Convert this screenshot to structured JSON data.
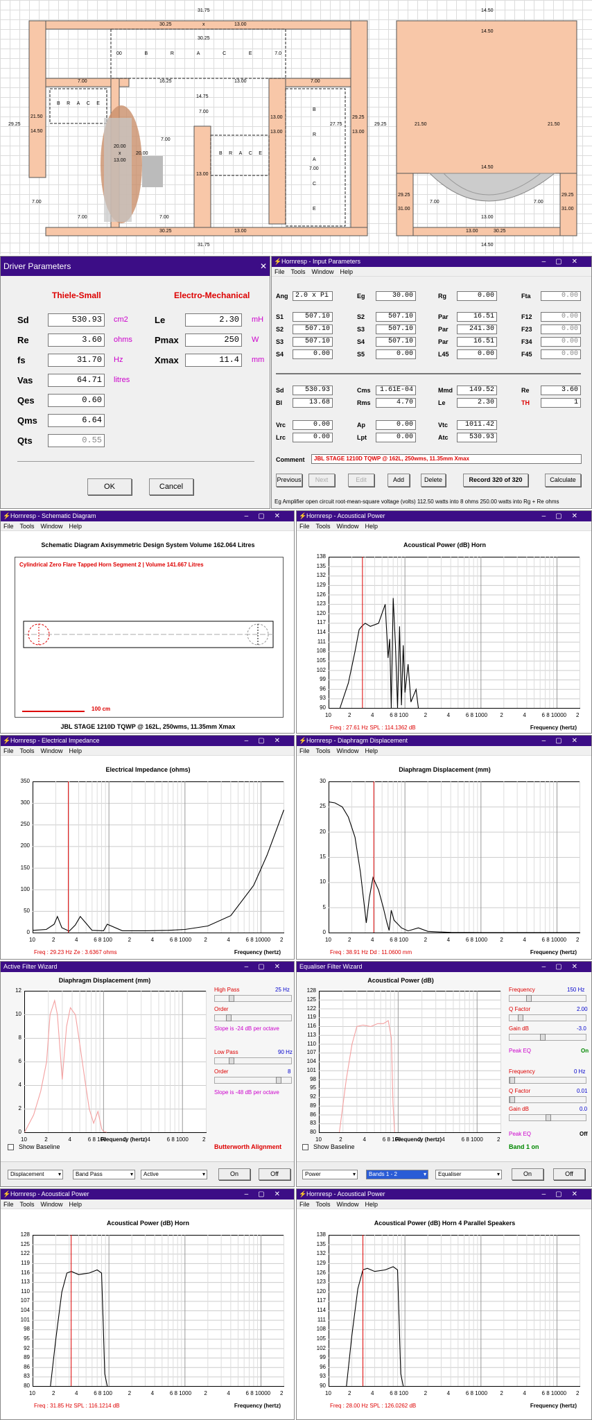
{
  "cad": {
    "left_dims": {
      "top_outer": "31.75",
      "top_a": "30.25",
      "top_b": "13.00",
      "brace_top_width": "30.25",
      "brace_top_letters": [
        "00",
        "B",
        "R",
        "A",
        "C",
        "E",
        "7.0"
      ],
      "left_height": "29.25",
      "left_inner_a": "21.50",
      "left_inner_b": "14.50",
      "left_seven": "7.00",
      "mid_a": "16.25",
      "mid_b": "13.00",
      "mid_right_seven": "7.00",
      "left_brace_width": "7.00",
      "left_brace_letters": [
        "B",
        "R",
        "A",
        "C",
        "E"
      ],
      "center_width": "14.75",
      "center_seven": "7.00",
      "driver_a": "20.00",
      "driver_b": "13.00",
      "driver_c": "20.00",
      "driver_x": "x",
      "mid_seven2": "7.00",
      "right_brace_letters": [
        "B",
        "R",
        "A",
        "C",
        "E"
      ],
      "right_col": "13.00",
      "right_col_b": "13.00",
      "right_col_c": "13.00",
      "vert_brace_letters": [
        "B",
        "R",
        "A",
        "C",
        "E"
      ],
      "vert_seven": "7.00",
      "right_a": "27.75",
      "right_outer": "29.25",
      "right_outer_b": "13.00",
      "bottom_seven_left": "7.00",
      "bottom_seven_mid": "7.00",
      "bottom_a": "30.25",
      "bottom_b": "13.00",
      "bottom_outer": "31.75",
      "low_left_seven": "7.00"
    },
    "right_dims": {
      "top_outer": "14.50",
      "top_inner": "14.50",
      "left_h": "29.25",
      "inner_a": "21.50",
      "inner_b": "21.50",
      "mid": "14.50",
      "port_a": "29.25",
      "port_b": "31.00",
      "port_c": "29.25",
      "port_d": "31.00",
      "seven_l": "7.00",
      "seven_r": "7.00",
      "inner_w": "13.00",
      "bottom_a": "13.00",
      "bottom_b": "30.25",
      "bottom_outer": "14.50"
    }
  },
  "driver": {
    "title": "Driver Parameters",
    "close": "✕",
    "h_ts": "Thiele-Small",
    "h_em": "Electro-Mechanical",
    "rows": [
      {
        "k": "Sd",
        "v": "530.93",
        "u": "cm2"
      },
      {
        "k": "Re",
        "v": "3.60",
        "u": "ohms"
      },
      {
        "k": "fs",
        "v": "31.70",
        "u": "Hz"
      },
      {
        "k": "Vas",
        "v": "64.71",
        "u": "litres"
      },
      {
        "k": "Qes",
        "v": "0.60",
        "u": ""
      },
      {
        "k": "Qms",
        "v": "6.64",
        "u": ""
      },
      {
        "k": "Qts",
        "v": "0.55",
        "u": ""
      }
    ],
    "em": [
      {
        "k": "Le",
        "v": "2.30",
        "u": "mH"
      },
      {
        "k": "Pmax",
        "v": "250",
        "u": "W"
      },
      {
        "k": "Xmax",
        "v": "11.4",
        "u": "mm"
      }
    ],
    "ok": "OK",
    "cancel": "Cancel"
  },
  "input": {
    "title": "Hornresp - Input Parameters",
    "menu": [
      "File",
      "Tools",
      "Window",
      "Help"
    ],
    "r0": [
      [
        "Ang",
        "2.0 x Pi"
      ],
      [
        "Eg",
        "30.00"
      ],
      [
        "Rg",
        "0.00"
      ],
      [
        "Fta",
        "0.00"
      ]
    ],
    "r1": [
      [
        "S1",
        "507.10"
      ],
      [
        "S2",
        "507.10"
      ],
      [
        "Par",
        "16.51"
      ],
      [
        "F12",
        "0.00"
      ]
    ],
    "r2": [
      [
        "S2",
        "507.10"
      ],
      [
        "S3",
        "507.10"
      ],
      [
        "Par",
        "241.30"
      ],
      [
        "F23",
        "0.00"
      ]
    ],
    "r3": [
      [
        "S3",
        "507.10"
      ],
      [
        "S4",
        "507.10"
      ],
      [
        "Par",
        "16.51"
      ],
      [
        "F34",
        "0.00"
      ]
    ],
    "r4": [
      [
        "S4",
        "0.00"
      ],
      [
        "S5",
        "0.00"
      ],
      [
        "L45",
        "0.00"
      ],
      [
        "F45",
        "0.00"
      ]
    ],
    "r5": [
      [
        "Sd",
        "530.93"
      ],
      [
        "Cms",
        "1.61E-04"
      ],
      [
        "Mmd",
        "149.52"
      ],
      [
        "Re",
        "3.60"
      ]
    ],
    "r6": [
      [
        "Bl",
        "13.68"
      ],
      [
        "Rms",
        "4.70"
      ],
      [
        "Le",
        "2.30"
      ],
      [
        "TH",
        "1"
      ]
    ],
    "r7": [
      [
        "Vrc",
        "0.00"
      ],
      [
        "Ap",
        "0.00"
      ],
      [
        "Vtc",
        "1011.42"
      ]
    ],
    "r8": [
      [
        "Lrc",
        "0.00"
      ],
      [
        "Lpt",
        "0.00"
      ],
      [
        "Atc",
        "530.93"
      ]
    ],
    "comment_label": "Comment",
    "comment": "JBL STAGE 1210D TQWP @ 162L, 250wms, 11.35mm Xmax",
    "buttons": [
      "Previous",
      "Next",
      "Edit",
      "Add",
      "Delete"
    ],
    "record": "Record 320 of 320",
    "calc": "Calculate",
    "status": "Eg   Amplifier open circuit root-mean-square voltage  (volts)   112.50 watts into 8 ohms   250.00 watts into Rg + Re ohms"
  },
  "schematic": {
    "title": "Hornresp - Schematic Diagram",
    "menu": [
      "File",
      "Tools",
      "Window",
      "Help"
    ],
    "head": "Schematic Diagram    Axisymmetric Design    System Volume 162.064 Litres",
    "seg": "Cylindrical Zero Flare Tapped Horn Segment 2 | Volume 141.667 Litres",
    "scale": "100 cm",
    "footer": "JBL STAGE 1210D TQWP @ 162L, 250wms, 11.35mm Xmax"
  },
  "acoustic1": {
    "title": "Hornresp - Acoustical Power",
    "menu": [
      "File",
      "Tools",
      "Window",
      "Help"
    ],
    "head": "Acoustical Power (dB)   Horn",
    "y": [
      "138",
      "135",
      "132",
      "129",
      "126",
      "123",
      "120",
      "117",
      "114",
      "111",
      "108",
      "105",
      "102",
      "99",
      "96",
      "93",
      "90"
    ],
    "x": [
      "10",
      "2",
      "4",
      "6 8 100",
      "2",
      "4",
      "6 8 1000",
      "2",
      "4",
      "6 8 10000",
      "2"
    ],
    "readout": "Freq : 27.61 Hz    SPL : 114.1362 dB",
    "xlabel": "Frequency (hertz)"
  },
  "impedance": {
    "title": "Hornresp - Electrical Impedance",
    "menu": [
      "File",
      "Tools",
      "Window",
      "Help"
    ],
    "head": "Electrical Impedance (ohms)",
    "y": [
      "350",
      "300",
      "250",
      "200",
      "150",
      "100",
      "50",
      "0"
    ],
    "x": [
      "10",
      "2",
      "4",
      "6 8 100",
      "2",
      "4",
      "6 8 1000",
      "2",
      "4",
      "6 8 10000",
      "2"
    ],
    "readout": "Freq : 29.23 Hz    Ze : 3.6367 ohms",
    "xlabel": "Frequency (hertz)"
  },
  "displacement": {
    "title": "Hornresp - Diaphragm Displacement",
    "menu": [
      "File",
      "Tools",
      "Window",
      "Help"
    ],
    "head": "Diaphragm Displacement (mm)",
    "y": [
      "30",
      "25",
      "20",
      "15",
      "10",
      "5",
      "0"
    ],
    "x": [
      "10",
      "2",
      "4",
      "6 8 100",
      "2",
      "4",
      "6 8 1000",
      "2",
      "4",
      "6 8 10000",
      "2"
    ],
    "readout": "Freq : 38.91 Hz    Dd : 11.0600 mm",
    "xlabel": "Frequency (hertz)"
  },
  "afw": {
    "title": "Active Filter Wizard",
    "head": "Diaphragm Displacement (mm)",
    "y": [
      "12",
      "10",
      "8",
      "6",
      "4",
      "2",
      "0"
    ],
    "x": [
      "10",
      "2",
      "4",
      "6 8 100",
      "2",
      "4",
      "6 8 1000",
      "2"
    ],
    "xlabel": "Frequency (hertz)",
    "baseline": "Show Baseline",
    "align": "Butterworth Alignment",
    "hp": "High Pass",
    "hp_val": "25 Hz",
    "order1": "Order",
    "slope1": "Slope is -24 dB per octave",
    "lp": "Low Pass",
    "lp_val": "90 Hz",
    "order2": "Order",
    "order2_val": "8",
    "slope2": "Slope is -48 dB per octave",
    "selects": [
      "Displacement",
      "Band Pass",
      "Active"
    ],
    "on": "On",
    "off": "Off"
  },
  "efw": {
    "title": "Equaliser Filter Wizard",
    "head": "Acoustical Power (dB)",
    "y": [
      "128",
      "125",
      "122",
      "119",
      "116",
      "113",
      "110",
      "107",
      "104",
      "101",
      "98",
      "95",
      "92",
      "89",
      "86",
      "83",
      "80"
    ],
    "x": [
      "10",
      "2",
      "4",
      "6 8 100",
      "2",
      "4",
      "6 8 1000",
      "2"
    ],
    "xlabel": "Frequency (hertz)",
    "baseline": "Show Baseline",
    "band": "Band 1 on",
    "f1": "Frequency",
    "f1_val": "150 Hz",
    "q1": "Q Factor",
    "q1_val": "2.00",
    "g1": "Gain  dB",
    "g1_val": "-3.0",
    "peak1": "Peak EQ",
    "peak1_val": "On",
    "f2": "Frequency",
    "f2_val": "0 Hz",
    "q2": "Q Factor",
    "q2_val": "0.01",
    "g2": "Gain  dB",
    "g2_val": "0.0",
    "peak2": "Peak EQ",
    "peak2_val": "Off",
    "selects": [
      "Power",
      "Bands 1 - 2",
      "Equaliser"
    ],
    "on": "On",
    "off": "Off"
  },
  "acoustic2": {
    "title": "Hornresp - Acoustical Power",
    "menu": [
      "File",
      "Tools",
      "Window",
      "Help"
    ],
    "head": "Acoustical Power (dB)   Horn",
    "y": [
      "128",
      "125",
      "122",
      "119",
      "116",
      "113",
      "110",
      "107",
      "104",
      "101",
      "98",
      "95",
      "92",
      "89",
      "86",
      "83",
      "80"
    ],
    "x": [
      "10",
      "2",
      "4",
      "6 8 100",
      "2",
      "4",
      "6 8 1000",
      "2",
      "4",
      "6 8 10000",
      "2"
    ],
    "readout": "Freq : 31.85 Hz    SPL : 116.1214 dB",
    "xlabel": "Frequency (hertz)"
  },
  "acoustic3": {
    "title": "Hornresp - Acoustical Power",
    "menu": [
      "File",
      "Tools",
      "Window",
      "Help"
    ],
    "head": "Acoustical Power (dB)   Horn   4 Parallel Speakers",
    "y": [
      "138",
      "135",
      "132",
      "129",
      "126",
      "123",
      "120",
      "117",
      "114",
      "111",
      "108",
      "105",
      "102",
      "99",
      "96",
      "93",
      "90"
    ],
    "x": [
      "10",
      "2",
      "4",
      "6 8 100",
      "2",
      "4",
      "6 8 1000",
      "2",
      "4",
      "6 8 10000",
      "2"
    ],
    "readout": "Freq : 28.00 Hz    SPL : 126.0262 dB",
    "xlabel": "Frequency (hertz)"
  },
  "chart_data": [
    {
      "type": "line",
      "title": "Acoustical Power (dB)   Horn",
      "xlabel": "Frequency (hertz)",
      "xscale": "log",
      "xlim": [
        10,
        20000
      ],
      "ylim": [
        90,
        138
      ],
      "grid": true,
      "marker_x": 27.61,
      "x": [
        14,
        18,
        22,
        25,
        27,
        30,
        35,
        45,
        55,
        60,
        63,
        66,
        70,
        75,
        80,
        85,
        90,
        95,
        100,
        110,
        120,
        140,
        150
      ],
      "series": [
        {
          "values": [
            90,
            98,
            108,
            115,
            116,
            117,
            116,
            117,
            123,
            106,
            112,
            90,
            125,
            110,
            90,
            116,
            91,
            110,
            95,
            104,
            92,
            96,
            90
          ]
        }
      ]
    },
    {
      "type": "line",
      "title": "Electrical Impedance (ohms)",
      "xlabel": "Frequency (hertz)",
      "xscale": "log",
      "xlim": [
        10,
        20000
      ],
      "ylim": [
        0,
        350
      ],
      "grid": true,
      "marker_x": 29.23,
      "x": [
        10,
        15,
        19,
        21,
        24,
        30,
        36,
        42,
        60,
        85,
        95,
        150,
        300,
        600,
        1000,
        2000,
        4000,
        8000,
        12000,
        20000
      ],
      "series": [
        {
          "values": [
            6,
            8,
            20,
            38,
            12,
            4,
            18,
            38,
            6,
            5,
            20,
            5,
            5,
            6,
            8,
            16,
            40,
            110,
            180,
            285
          ]
        }
      ]
    },
    {
      "type": "line",
      "title": "Diaphragm Displacement (mm)",
      "xlabel": "Frequency (hertz)",
      "xscale": "log",
      "xlim": [
        10,
        20000
      ],
      "ylim": [
        0,
        30
      ],
      "grid": true,
      "marker_x": 38.91,
      "x": [
        10,
        12,
        15,
        18,
        22,
        26,
        31,
        34,
        38,
        45,
        52,
        58,
        62,
        66,
        72,
        80,
        90,
        110,
        150,
        200,
        400,
        1000,
        20000
      ],
      "series": [
        {
          "values": [
            26,
            25.8,
            25,
            23,
            19,
            12,
            2,
            7,
            11,
            8.5,
            5,
            2,
            0.5,
            4.5,
            2.5,
            1.8,
            1,
            0.4,
            1,
            0.3,
            0.1,
            0.05,
            0
          ]
        }
      ]
    },
    {
      "type": "line",
      "title": "Diaphragm Displacement (mm)",
      "xlabel": "Frequency (hertz)",
      "xscale": "log",
      "xlim": [
        10,
        20000
      ],
      "ylim": [
        0,
        12
      ],
      "grid": true,
      "x": [
        10,
        13,
        16,
        19,
        21,
        24,
        26,
        30,
        34,
        38,
        44,
        50,
        58,
        66,
        75,
        85,
        95,
        100,
        110
      ],
      "series": [
        {
          "values": [
            0,
            1.5,
            3.5,
            6,
            10,
            11.2,
            10,
            4.5,
            9,
            10.6,
            10,
            7.5,
            4.5,
            2,
            0.8,
            1.8,
            0.3,
            0.1,
            0
          ]
        }
      ]
    },
    {
      "type": "line",
      "title": "Acoustical Power (dB)",
      "xlabel": "Frequency (hertz)",
      "xscale": "log",
      "xlim": [
        10,
        20000
      ],
      "ylim": [
        80,
        128
      ],
      "grid": true,
      "x": [
        18,
        22,
        26,
        30,
        36,
        45,
        55,
        65,
        75,
        82,
        86,
        90
      ],
      "series": [
        {
          "values": [
            80,
            98,
            110,
            116,
            116.5,
            116,
            117,
            117,
            118,
            112,
            90,
            80
          ]
        }
      ]
    },
    {
      "type": "line",
      "title": "Acoustical Power (dB)   Horn",
      "xlabel": "Frequency (hertz)",
      "xscale": "log",
      "xlim": [
        10,
        20000
      ],
      "ylim": [
        80,
        128
      ],
      "grid": true,
      "marker_x": 31.85,
      "x": [
        17,
        20,
        24,
        28,
        32,
        40,
        55,
        70,
        80,
        84,
        88,
        95
      ],
      "series": [
        {
          "values": [
            80,
            95,
            110,
            116,
            116.5,
            115.5,
            116,
            117,
            116,
            100,
            84,
            80
          ]
        }
      ]
    },
    {
      "type": "line",
      "title": "Acoustical Power (dB)   Horn   4 Parallel Speakers",
      "xlabel": "Frequency (hertz)",
      "xscale": "log",
      "xlim": [
        10,
        20000
      ],
      "ylim": [
        90,
        138
      ],
      "grid": true,
      "marker_x": 28.0,
      "x": [
        17,
        20,
        24,
        28,
        32,
        40,
        55,
        70,
        80,
        84,
        88,
        95
      ],
      "series": [
        {
          "values": [
            90,
            106,
            121,
            127,
            127.5,
            126.5,
            127,
            128,
            127,
            110,
            94,
            90
          ]
        }
      ]
    }
  ]
}
